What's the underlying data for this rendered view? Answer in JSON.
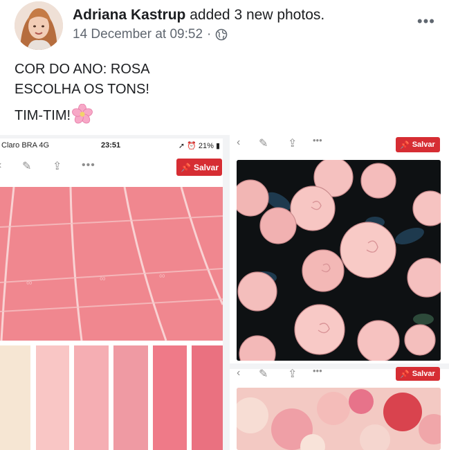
{
  "post": {
    "author": "Adriana Kastrup",
    "action": "added 3 new photos.",
    "timestamp": "14 December at 09:52",
    "separator": "·",
    "privacy_icon": "globe-icon",
    "more_label": "•••",
    "text_lines": [
      "COR DO ANO: ROSA",
      "ESCOLHA OS TONS!",
      "TIM-TIM!"
    ],
    "emoji": "cherry-blossom-icon"
  },
  "photos": {
    "left": {
      "carrier": "Claro BRA  4G",
      "time": "23:51",
      "battery": "21%",
      "save_label": "Salvar",
      "swatch_colors": [
        "#f6e6d3",
        "#f9c6c5",
        "#f5aeb3",
        "#ef9aa3",
        "#ef7a88",
        "#ea7180"
      ]
    },
    "right": {
      "save_label_1": "Salvar",
      "save_label_2": "Salvar"
    }
  },
  "colors": {
    "save_red": "#d62d33",
    "track_pink": "#ee7d86"
  }
}
